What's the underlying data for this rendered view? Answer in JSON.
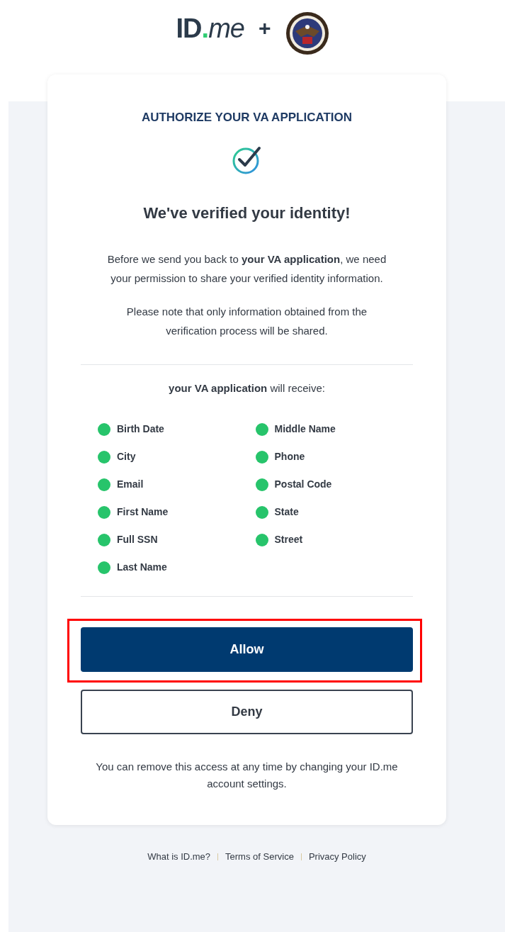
{
  "header": {
    "logo": {
      "name": "ID",
      "dot": ".",
      "suffix": "me"
    },
    "plus": "+"
  },
  "card": {
    "title": "AUTHORIZE YOUR VA APPLICATION",
    "heading": "We've verified your identity!",
    "paragraphs": [
      "Before we send you back to **your VA application**, we need your permission to share your verified identity information.",
      "Please note that only information obtained from the verification process will be shared."
    ],
    "receive_label": "**your VA application** will receive:",
    "attributes": [
      {
        "label": "Birth Date"
      },
      {
        "label": "City"
      },
      {
        "label": "Email"
      },
      {
        "label": "First Name"
      },
      {
        "label": "Full SSN"
      },
      {
        "label": "Last Name"
      },
      {
        "label": "Middle Name"
      },
      {
        "label": "Phone"
      },
      {
        "label": "Postal Code"
      },
      {
        "label": "State"
      },
      {
        "label": "Street"
      }
    ],
    "buttons": [
      {
        "label": "Allow",
        "kind": "primary",
        "highlighted": true
      },
      {
        "label": "Deny",
        "kind": "secondary",
        "highlighted": false
      }
    ],
    "note": "You can remove this access at any time by changing your ID.me account settings."
  },
  "footer_links": [
    "What is ID.me?",
    "Terms of Service",
    "Privacy Policy"
  ]
}
